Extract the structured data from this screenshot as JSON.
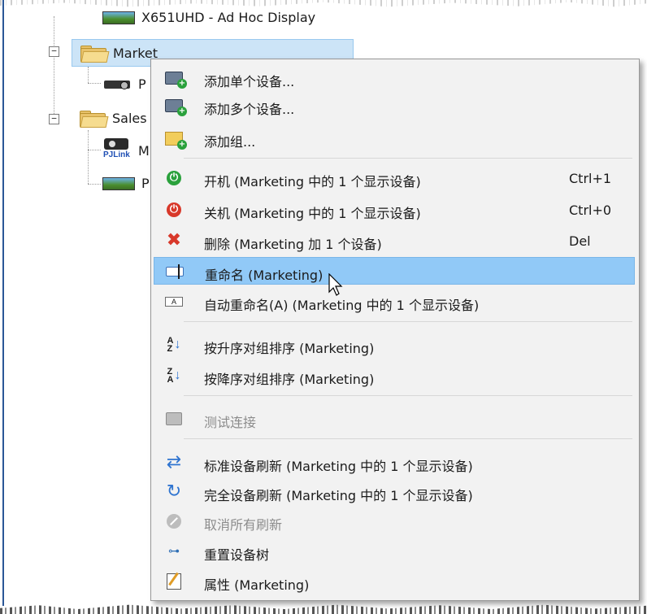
{
  "tree": {
    "top_item_label": "X651UHD - Ad Hoc Display",
    "expander_collapse": "⊟",
    "groups": [
      {
        "label": "Marketing",
        "selected": true,
        "children": [
          {
            "label": "P",
            "icon": "projector-icon"
          }
        ]
      },
      {
        "label": "Sales",
        "selected": false,
        "children": [
          {
            "label": "M",
            "icon": "pjlink-projector-icon",
            "badge": "PJLink"
          },
          {
            "label": "P",
            "icon": "display-icon"
          }
        ]
      }
    ],
    "marketing_partial_label": "Market"
  },
  "context_menu": {
    "items": [
      {
        "label": "添加单个设备...",
        "icon": "add-device-icon",
        "shortcut": ""
      },
      {
        "label": "添加多个设备...",
        "icon": "add-multiple-devices-icon",
        "shortcut": ""
      },
      {
        "label": "添加组...",
        "icon": "add-group-icon",
        "shortcut": ""
      },
      {
        "label": "开机 (Marketing 中的 1 个显示设备)",
        "icon": "power-on-icon",
        "shortcut": "Ctrl+1",
        "color": "#2aa13c"
      },
      {
        "label": "关机 (Marketing 中的 1 个显示设备)",
        "icon": "power-off-icon",
        "shortcut": "Ctrl+0",
        "color": "#d8382a"
      },
      {
        "label": "删除 (Marketing 加 1 个设备)",
        "icon": "delete-icon",
        "shortcut": "Del"
      },
      {
        "label": "重命名 (Marketing)",
        "icon": "rename-icon",
        "shortcut": "",
        "highlighted": true
      },
      {
        "label": "自动重命名(A) (Marketing 中的 1 个显示设备)",
        "icon": "auto-rename-icon",
        "shortcut": "",
        "icon_text": "A"
      },
      {
        "label": "按升序对组排序 (Marketing)",
        "icon": "sort-ascending-icon",
        "shortcut": "",
        "icon_text": "A Z"
      },
      {
        "label": "按降序对组排序 (Marketing)",
        "icon": "sort-descending-icon",
        "shortcut": "",
        "icon_text": "Z A"
      },
      {
        "label": "测试连接",
        "icon": "test-connection-icon",
        "shortcut": "",
        "disabled": true
      },
      {
        "label": "标准设备刷新 (Marketing 中的 1 个显示设备)",
        "icon": "standard-refresh-icon",
        "shortcut": ""
      },
      {
        "label": "完全设备刷新 (Marketing 中的 1 个显示设备)",
        "icon": "full-refresh-icon",
        "shortcut": ""
      },
      {
        "label": "取消所有刷新",
        "icon": "cancel-refresh-icon",
        "shortcut": "",
        "disabled": true
      },
      {
        "label": "重置设备树",
        "icon": "reset-tree-icon",
        "shortcut": ""
      },
      {
        "label": "属性 (Marketing)",
        "icon": "properties-icon",
        "shortcut": ""
      }
    ],
    "highlight_color": "#91c9f7",
    "background_color": "#f2f2f2"
  }
}
